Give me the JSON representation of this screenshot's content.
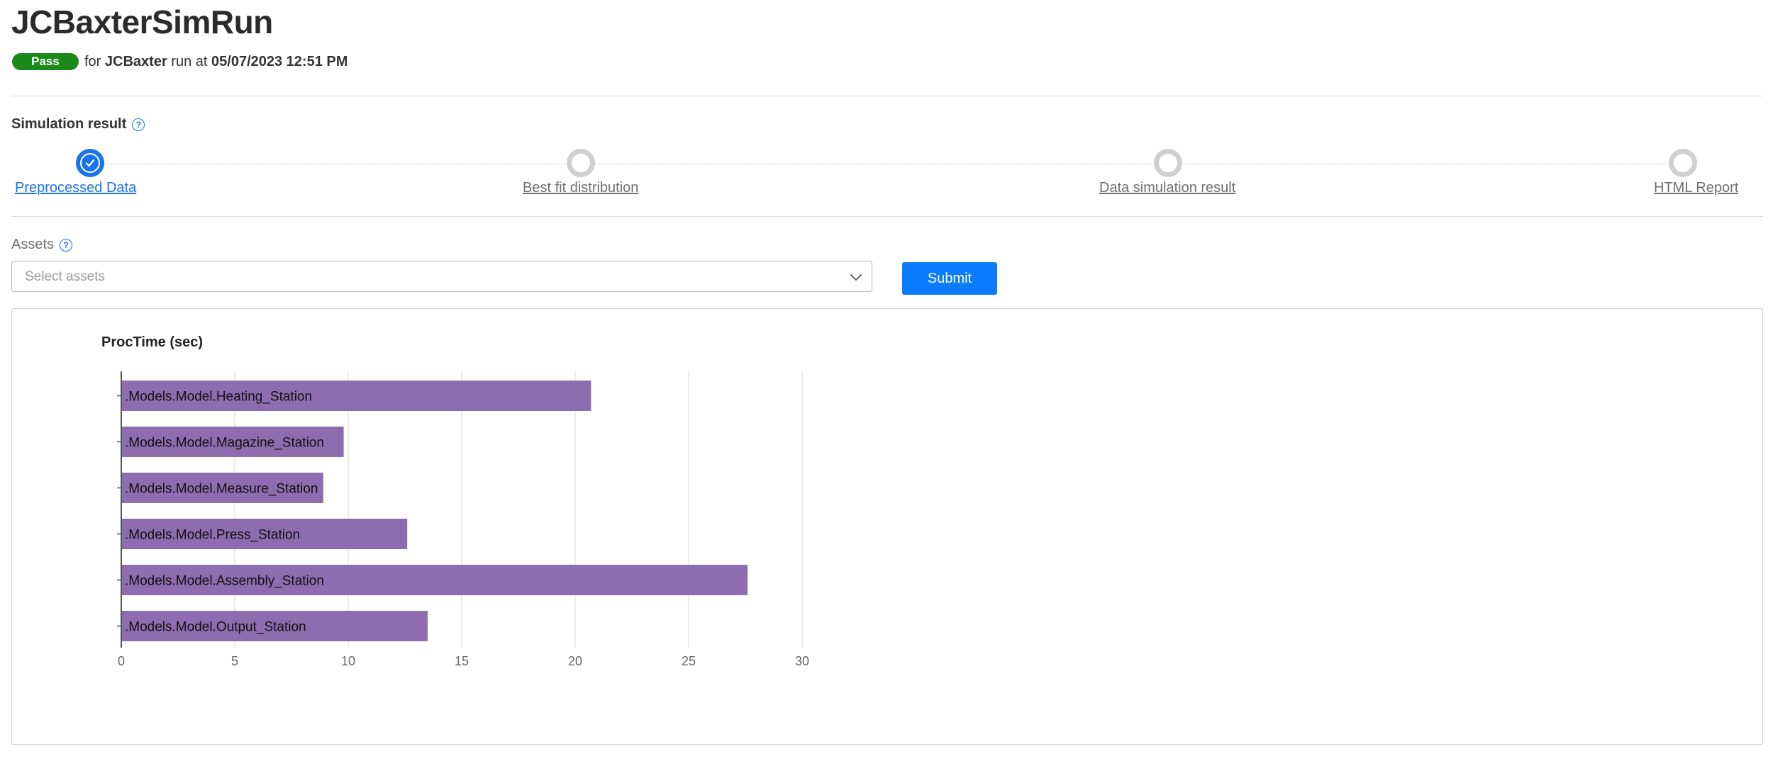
{
  "page": {
    "title": "JCBaxterSimRun",
    "status": "Pass",
    "run_prefix": "for",
    "run_user": "JCBaxter",
    "run_middle": "run at",
    "run_time": "05/07/2023 12:51 PM"
  },
  "simulation": {
    "label": "Simulation result",
    "help_icon": "question-circle-icon",
    "steps": [
      {
        "label": "Preprocessed Data",
        "state": "done"
      },
      {
        "label": "Best fit distribution",
        "state": "pending"
      },
      {
        "label": "Data simulation result",
        "state": "pending"
      },
      {
        "label": "HTML Report",
        "state": "pending"
      }
    ]
  },
  "assets": {
    "label": "Assets",
    "placeholder": "Select assets",
    "value": "",
    "submit_label": "Submit"
  },
  "colors": {
    "accent": "#0a7cff",
    "pass": "#1b8a1b",
    "bar": "#8e6cb0"
  },
  "chart_data": {
    "type": "bar",
    "orientation": "horizontal",
    "title": "ProcTime (sec)",
    "categories": [
      ".Models.Model.Heating_Station",
      ".Models.Model.Magazine_Station",
      ".Models.Model.Measure_Station",
      ".Models.Model.Press_Station",
      ".Models.Model.Assembly_Station",
      ".Models.Model.Output_Station"
    ],
    "values": [
      20.7,
      9.8,
      8.9,
      12.6,
      27.6,
      13.5
    ],
    "xlim": [
      0,
      30
    ],
    "xticks": [
      0,
      5,
      10,
      15,
      20,
      25,
      30
    ],
    "grid": true,
    "legend": "none"
  }
}
